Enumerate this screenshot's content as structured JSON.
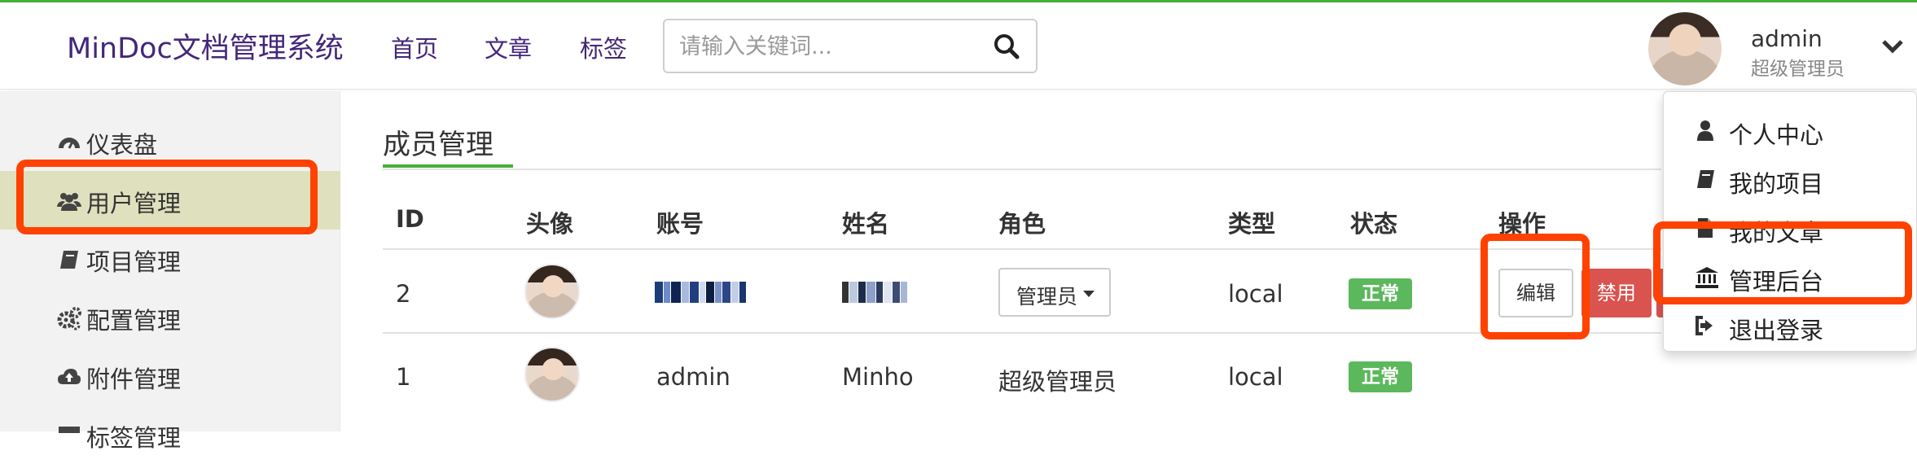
{
  "header": {
    "brand": "MinDoc文档管理系统",
    "nav": [
      "首页",
      "文章",
      "标签"
    ],
    "search_placeholder": "请输入关键词...",
    "user": {
      "name": "admin",
      "role": "超级管理员"
    }
  },
  "sidebar": {
    "items": [
      {
        "label": "仪表盘",
        "icon": "dashboard-icon"
      },
      {
        "label": "用户管理",
        "icon": "users-icon"
      },
      {
        "label": "项目管理",
        "icon": "book-icon"
      },
      {
        "label": "配置管理",
        "icon": "cogs-icon"
      },
      {
        "label": "附件管理",
        "icon": "cloud-upload-icon"
      },
      {
        "label": "标签管理",
        "icon": "tag-icon"
      }
    ],
    "active_index": 1
  },
  "main": {
    "title": "成员管理",
    "columns": [
      "ID",
      "头像",
      "账号",
      "姓名",
      "角色",
      "类型",
      "状态",
      "操作"
    ],
    "rows": [
      {
        "id": "2",
        "account": "",
        "name": "",
        "role": "管理员",
        "type": "local",
        "status": "正常",
        "actions": {
          "edit": "编辑",
          "ban": "禁用"
        }
      },
      {
        "id": "1",
        "account": "admin",
        "name": "Minho",
        "role": "超级管理员",
        "type": "local",
        "status": "正常"
      }
    ]
  },
  "dropdown": {
    "items": [
      {
        "label": "个人中心",
        "icon": "user-icon"
      },
      {
        "label": "我的项目",
        "icon": "book-icon"
      },
      {
        "label": "我的文章",
        "icon": "file-icon"
      },
      {
        "label": "管理后台",
        "icon": "bank-icon"
      },
      {
        "label": "退出登录",
        "icon": "sign-out-icon"
      }
    ]
  },
  "colors": {
    "accent_green": "#44b036",
    "brand_purple": "#44277a",
    "highlight": "#ff4200",
    "active_sidebar": "#dfe0bd",
    "success": "#5cb85c",
    "danger": "#d9534f"
  }
}
